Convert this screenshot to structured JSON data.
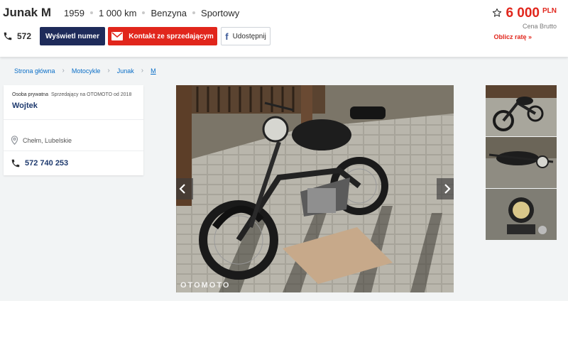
{
  "header": {
    "title": "Junak M",
    "params": [
      "1959",
      "1 000 km",
      "Benzyna",
      "Sportowy"
    ],
    "phone_short": "572",
    "btn_show_number": "Wyświetl numer",
    "btn_contact": "Kontakt ze sprzedającym",
    "btn_share": "Udostępnij",
    "price": "6 000",
    "currency": "PLN",
    "price_note": "Cena Brutto",
    "calc_link": "Oblicz ratę »"
  },
  "breadcrumb": [
    "Strona główna",
    "Motocykle",
    "Junak",
    "M"
  ],
  "seller": {
    "type": "Osoba prywatna",
    "since": "Sprzedający na OTOMOTO od 2018",
    "name": "Wojtek",
    "location": "Chełm, Lubelskie",
    "phone": "572 740 253"
  },
  "gallery": {
    "watermark": "OTOMOTO",
    "thumb_count": 3
  },
  "colors": {
    "accent_red": "#e1261c",
    "navy": "#1e2b5a",
    "link_blue": "#0a6ec7"
  }
}
